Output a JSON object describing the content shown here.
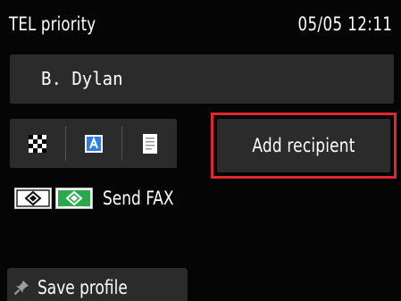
{
  "status": {
    "title": "TEL priority",
    "datetime": "05/05 12:11"
  },
  "recipient": {
    "name": "B. Dylan"
  },
  "settings": {
    "items": [
      {
        "icon": "resolution-icon"
      },
      {
        "icon": "scan-contrast-icon"
      },
      {
        "icon": "document-icon"
      }
    ]
  },
  "add_recipient": {
    "label": "Add recipient",
    "highlight_color": "#e2262e"
  },
  "send": {
    "label": "Send FAX",
    "black_key_icon": "black-start-key-icon",
    "color_key_icon": "color-start-key-icon",
    "color_key_color": "#2aa84a"
  },
  "save_profile": {
    "label": "Save profile",
    "icon": "pin-icon"
  },
  "colors": {
    "background": "#050505",
    "button": "#2b2b2b",
    "text": "#ffffff"
  }
}
